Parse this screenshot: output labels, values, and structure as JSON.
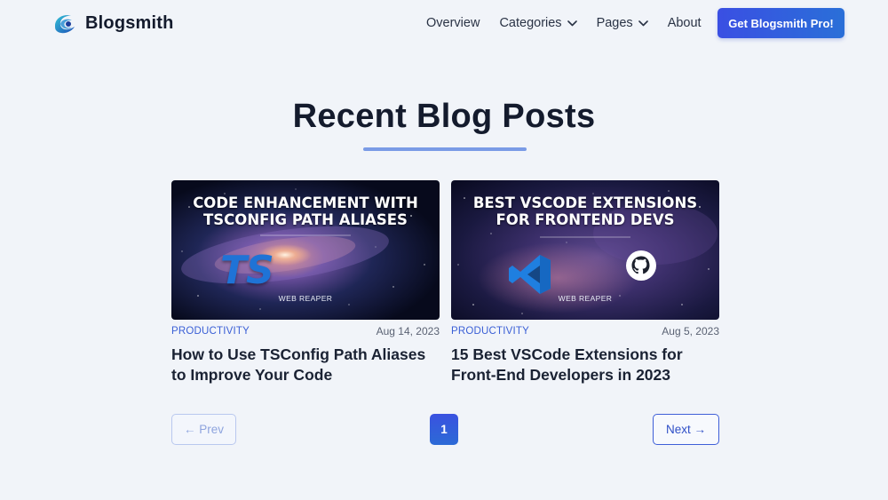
{
  "brand": {
    "name": "Blogsmith",
    "logo_icon": "blogsmith-wave-logo"
  },
  "nav": {
    "items": [
      {
        "label": "Overview",
        "has_dropdown": false
      },
      {
        "label": "Categories",
        "has_dropdown": true
      },
      {
        "label": "Pages",
        "has_dropdown": true
      },
      {
        "label": "About",
        "has_dropdown": false
      }
    ],
    "cta_label": "Get Blogsmith Pro!"
  },
  "main": {
    "title": "Recent Blog Posts",
    "posts": [
      {
        "category": "PRODUCTIVITY",
        "date": "Aug 14, 2023",
        "title": "How to Use TSConfig Path Aliases to Improve Your Code",
        "thumbnail": {
          "title_line1": "CODE ENHANCEMENT WITH",
          "title_line2": "TSCONFIG PATH ALIASES",
          "logo_text": "TS",
          "brand": "WEB REAPER"
        }
      },
      {
        "category": "PRODUCTIVITY",
        "date": "Aug 5, 2023",
        "title": "15 Best VSCode Extensions for Front-End Developers in 2023",
        "thumbnail": {
          "title_line1": "BEST VSCODE EXTENSIONS",
          "title_line2": "FOR FRONTEND DEVS",
          "icons": [
            "vscode-icon",
            "github-icon"
          ],
          "brand": "WEB REAPER"
        }
      }
    ]
  },
  "pagination": {
    "prev_label": "← Prev",
    "current_page": "1",
    "next_label": "Next →"
  },
  "colors": {
    "accent": "#3a4fe3",
    "background": "#f1f4f9",
    "category": "#3a5fd6"
  }
}
